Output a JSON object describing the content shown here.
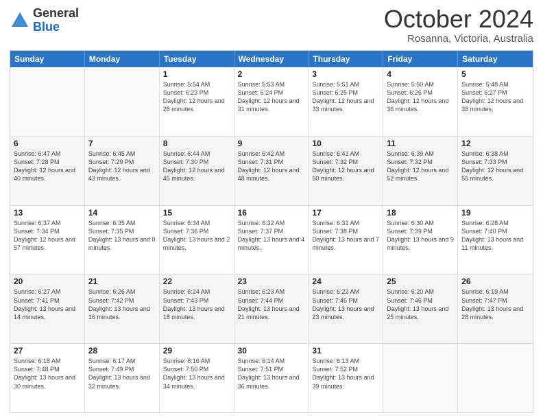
{
  "header": {
    "logo_general": "General",
    "logo_blue": "Blue",
    "month_title": "October 2024",
    "subtitle": "Rosanna, Victoria, Australia"
  },
  "days_of_week": [
    "Sunday",
    "Monday",
    "Tuesday",
    "Wednesday",
    "Thursday",
    "Friday",
    "Saturday"
  ],
  "weeks": [
    [
      {
        "day": "",
        "empty": true
      },
      {
        "day": "",
        "empty": true
      },
      {
        "day": "1",
        "sunrise": "Sunrise: 5:54 AM",
        "sunset": "Sunset: 6:23 PM",
        "daylight": "Daylight: 12 hours and 28 minutes."
      },
      {
        "day": "2",
        "sunrise": "Sunrise: 5:53 AM",
        "sunset": "Sunset: 6:24 PM",
        "daylight": "Daylight: 12 hours and 31 minutes."
      },
      {
        "day": "3",
        "sunrise": "Sunrise: 5:51 AM",
        "sunset": "Sunset: 6:25 PM",
        "daylight": "Daylight: 12 hours and 33 minutes."
      },
      {
        "day": "4",
        "sunrise": "Sunrise: 5:50 AM",
        "sunset": "Sunset: 6:26 PM",
        "daylight": "Daylight: 12 hours and 36 minutes."
      },
      {
        "day": "5",
        "sunrise": "Sunrise: 5:48 AM",
        "sunset": "Sunset: 6:27 PM",
        "daylight": "Daylight: 12 hours and 38 minutes."
      }
    ],
    [
      {
        "day": "6",
        "sunrise": "Sunrise: 6:47 AM",
        "sunset": "Sunset: 7:28 PM",
        "daylight": "Daylight: 12 hours and 40 minutes."
      },
      {
        "day": "7",
        "sunrise": "Sunrise: 6:45 AM",
        "sunset": "Sunset: 7:29 PM",
        "daylight": "Daylight: 12 hours and 43 minutes."
      },
      {
        "day": "8",
        "sunrise": "Sunrise: 6:44 AM",
        "sunset": "Sunset: 7:30 PM",
        "daylight": "Daylight: 12 hours and 45 minutes."
      },
      {
        "day": "9",
        "sunrise": "Sunrise: 6:42 AM",
        "sunset": "Sunset: 7:31 PM",
        "daylight": "Daylight: 12 hours and 48 minutes."
      },
      {
        "day": "10",
        "sunrise": "Sunrise: 6:41 AM",
        "sunset": "Sunset: 7:32 PM",
        "daylight": "Daylight: 12 hours and 50 minutes."
      },
      {
        "day": "11",
        "sunrise": "Sunrise: 6:39 AM",
        "sunset": "Sunset: 7:32 PM",
        "daylight": "Daylight: 12 hours and 52 minutes."
      },
      {
        "day": "12",
        "sunrise": "Sunrise: 6:38 AM",
        "sunset": "Sunset: 7:33 PM",
        "daylight": "Daylight: 12 hours and 55 minutes."
      }
    ],
    [
      {
        "day": "13",
        "sunrise": "Sunrise: 6:37 AM",
        "sunset": "Sunset: 7:34 PM",
        "daylight": "Daylight: 12 hours and 57 minutes."
      },
      {
        "day": "14",
        "sunrise": "Sunrise: 6:35 AM",
        "sunset": "Sunset: 7:35 PM",
        "daylight": "Daylight: 13 hours and 0 minutes."
      },
      {
        "day": "15",
        "sunrise": "Sunrise: 6:34 AM",
        "sunset": "Sunset: 7:36 PM",
        "daylight": "Daylight: 13 hours and 2 minutes."
      },
      {
        "day": "16",
        "sunrise": "Sunrise: 6:32 AM",
        "sunset": "Sunset: 7:37 PM",
        "daylight": "Daylight: 13 hours and 4 minutes."
      },
      {
        "day": "17",
        "sunrise": "Sunrise: 6:31 AM",
        "sunset": "Sunset: 7:38 PM",
        "daylight": "Daylight: 13 hours and 7 minutes."
      },
      {
        "day": "18",
        "sunrise": "Sunrise: 6:30 AM",
        "sunset": "Sunset: 7:39 PM",
        "daylight": "Daylight: 13 hours and 9 minutes."
      },
      {
        "day": "19",
        "sunrise": "Sunrise: 6:28 AM",
        "sunset": "Sunset: 7:40 PM",
        "daylight": "Daylight: 13 hours and 11 minutes."
      }
    ],
    [
      {
        "day": "20",
        "sunrise": "Sunrise: 6:27 AM",
        "sunset": "Sunset: 7:41 PM",
        "daylight": "Daylight: 13 hours and 14 minutes."
      },
      {
        "day": "21",
        "sunrise": "Sunrise: 6:26 AM",
        "sunset": "Sunset: 7:42 PM",
        "daylight": "Daylight: 13 hours and 16 minutes."
      },
      {
        "day": "22",
        "sunrise": "Sunrise: 6:24 AM",
        "sunset": "Sunset: 7:43 PM",
        "daylight": "Daylight: 13 hours and 18 minutes."
      },
      {
        "day": "23",
        "sunrise": "Sunrise: 6:23 AM",
        "sunset": "Sunset: 7:44 PM",
        "daylight": "Daylight: 13 hours and 21 minutes."
      },
      {
        "day": "24",
        "sunrise": "Sunrise: 6:22 AM",
        "sunset": "Sunset: 7:45 PM",
        "daylight": "Daylight: 13 hours and 23 minutes."
      },
      {
        "day": "25",
        "sunrise": "Sunrise: 6:20 AM",
        "sunset": "Sunset: 7:46 PM",
        "daylight": "Daylight: 13 hours and 25 minutes."
      },
      {
        "day": "26",
        "sunrise": "Sunrise: 6:19 AM",
        "sunset": "Sunset: 7:47 PM",
        "daylight": "Daylight: 13 hours and 28 minutes."
      }
    ],
    [
      {
        "day": "27",
        "sunrise": "Sunrise: 6:18 AM",
        "sunset": "Sunset: 7:48 PM",
        "daylight": "Daylight: 13 hours and 30 minutes."
      },
      {
        "day": "28",
        "sunrise": "Sunrise: 6:17 AM",
        "sunset": "Sunset: 7:49 PM",
        "daylight": "Daylight: 13 hours and 32 minutes."
      },
      {
        "day": "29",
        "sunrise": "Sunrise: 6:16 AM",
        "sunset": "Sunset: 7:50 PM",
        "daylight": "Daylight: 13 hours and 34 minutes."
      },
      {
        "day": "30",
        "sunrise": "Sunrise: 6:14 AM",
        "sunset": "Sunset: 7:51 PM",
        "daylight": "Daylight: 13 hours and 36 minutes."
      },
      {
        "day": "31",
        "sunrise": "Sunrise: 6:13 AM",
        "sunset": "Sunset: 7:52 PM",
        "daylight": "Daylight: 13 hours and 39 minutes."
      },
      {
        "day": "",
        "empty": true
      },
      {
        "day": "",
        "empty": true
      }
    ]
  ]
}
